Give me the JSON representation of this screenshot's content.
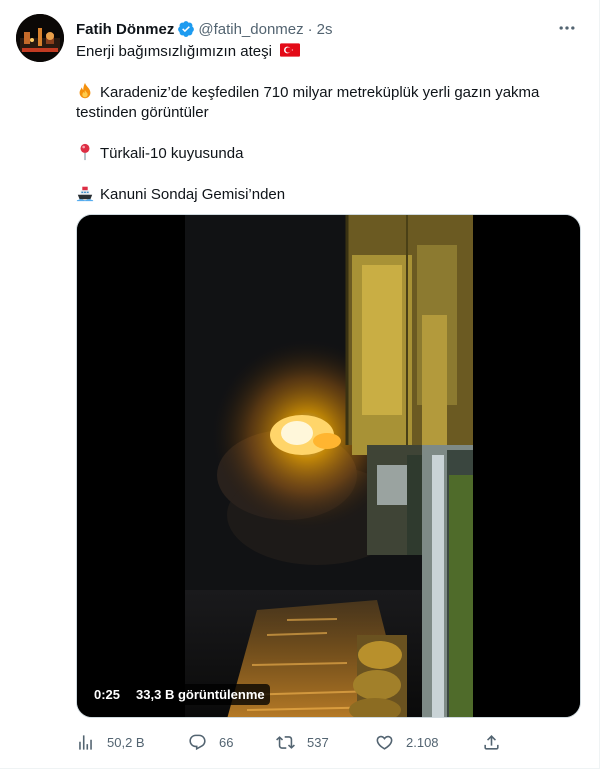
{
  "tweet": {
    "author_name": "Fatih Dönmez",
    "handle": "@fatih_donmez",
    "separator": "·",
    "time": "2s",
    "lines": [
      "Enerji bağımsızlığımızın ateşi",
      "",
      "Karadeniz’de keşfedilen 710 milyar metreküplük yerli gazın yakma testinden görüntüler",
      "",
      "Türkali-10 kuyusunda",
      "",
      "Kanuni Sondaj Gemisi’nden"
    ],
    "emoji_icons": [
      "turkey-flag-icon",
      "fire-icon",
      "round-pushpin-icon",
      "ship-icon"
    ]
  },
  "media": {
    "type": "video",
    "duration": "0:25",
    "views": "33,3 B görüntülenme"
  },
  "actions": {
    "views": "50,2 B",
    "replies": "66",
    "retweets": "537",
    "likes": "2.108"
  },
  "colors": {
    "verified": "#1d9bf0",
    "secondary_text": "#536471",
    "text": "#0f1419",
    "flag_red": "#e30a17",
    "flame": "#ffb000"
  }
}
